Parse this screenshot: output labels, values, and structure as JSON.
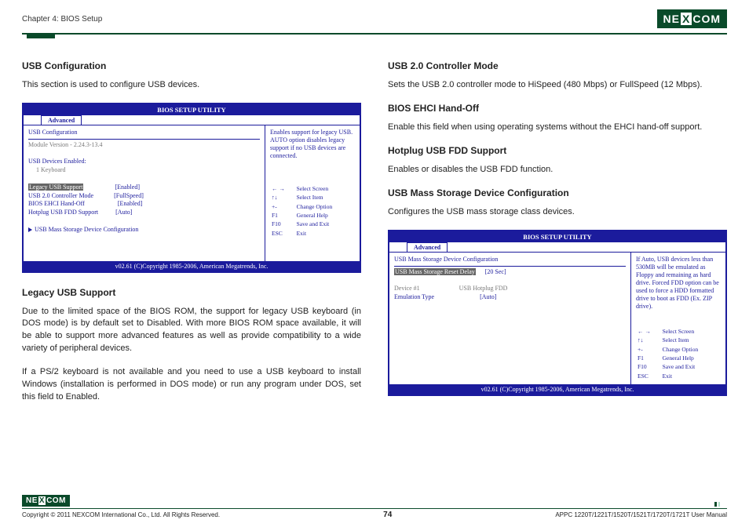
{
  "header": {
    "chapter": "Chapter 4: BIOS Setup",
    "brand": "NE COM",
    "brand_x": "X"
  },
  "left": {
    "h1": "USB Configuration",
    "p1": "This section is used to configure USB devices.",
    "h2": "Legacy USB Support",
    "p2": "Due to the limited space of the BIOS ROM, the support for legacy USB keyboard (in DOS mode) is by default set to Disabled. With more BIOS ROM space available, it will be able to support more advanced features as well as provide compatibility to a wide variety of peripheral devices.",
    "p3": "If a PS/2 keyboard is not available and you need to use a USB keyboard to install Windows (installation is performed in DOS mode) or run any program under DOS, set this field to Enabled."
  },
  "right": {
    "h1": "USB 2.0 Controller Mode",
    "p1": "Sets the USB 2.0 controller mode to HiSpeed (480 Mbps) or FullSpeed (12 Mbps).",
    "h2": "BIOS EHCI Hand-Off",
    "p2": "Enable this field when using operating systems without the EHCI hand-off support.",
    "h3": "Hotplug USB FDD Support",
    "p3": "Enables or disables the USB FDD function.",
    "h4": "USB Mass Storage Device Configuration",
    "p4": "Configures the USB mass storage class devices."
  },
  "bios1": {
    "title": "BIOS SETUP UTILITY",
    "tab": "Advanced",
    "section": "USB Configuration",
    "module": "Module Version - 2.24.3-13.4",
    "devices_label": "USB Devices Enabled:",
    "devices_value": "1 Keyboard",
    "row1_label": "Legacy USB Support",
    "row1_val": "[Enabled]",
    "row2_label": "USB 2.0 Controller Mode",
    "row2_val": "[FullSpeed]",
    "row3_label": "BIOS EHCI Hand-Off",
    "row3_val": "[Enabled]",
    "row4_label": "Hotplug USB FDD Support",
    "row4_val": "[Auto]",
    "submenu": "USB Mass Storage Device Configuration",
    "help": "Enables support for legacy USB. AUTO option disables legacy support if no USB devices are connected.",
    "footer": "v02.61 (C)Copyright 1985-2006, American Megatrends, Inc."
  },
  "bios2": {
    "title": "BIOS SETUP UTILITY",
    "tab": "Advanced",
    "section": "USB Mass Storage Device Configuration",
    "row1_label": "USB Mass Storage Reset Delay",
    "row1_val": "[20 Sec]",
    "dev_label": "Device #1",
    "dev_val": "USB Hotplug FDD",
    "emu_label": "Emulation Type",
    "emu_val": "[Auto]",
    "help": "If Auto, USB devices less than 530MB will be emulated as Floppy and remaining as hard drive. Forced FDD option can be used to force a HDD formatted drive to boot as FDD (Ex. ZIP drive).",
    "footer": "v02.61 (C)Copyright 1985-2006, American Megatrends, Inc."
  },
  "nav": {
    "k1": "←  →",
    "v1": "Select Screen",
    "k2": "↑↓",
    "v2": "Select Item",
    "k3": "+-",
    "v3": "Change Option",
    "k4": "F1",
    "v4": "General Help",
    "k5": "F10",
    "v5": "Save and Exit",
    "k6": "ESC",
    "v6": "Exit"
  },
  "footer": {
    "copyright": "Copyright © 2011 NEXCOM International Co., Ltd. All Rights Reserved.",
    "page": "74",
    "manual": "APPC 1220T/1221T/1520T/1521T/1720T/1721T User Manual"
  }
}
